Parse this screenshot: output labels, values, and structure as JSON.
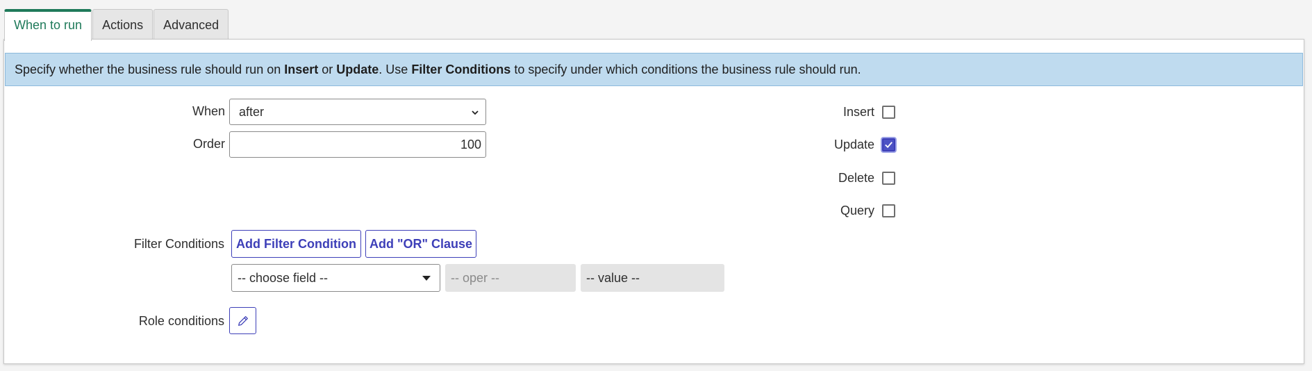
{
  "tabs": [
    {
      "label": "When to run"
    },
    {
      "label": "Actions"
    },
    {
      "label": "Advanced"
    }
  ],
  "info": {
    "t1": "Specify whether the business rule should run on ",
    "insert": "Insert",
    "t2": " or ",
    "update": "Update",
    "t3": ". Use ",
    "filter": "Filter Conditions",
    "t4": " to specify under which conditions the business rule should run."
  },
  "form": {
    "when_label": "When",
    "when_value": "after",
    "order_label": "Order",
    "order_value": "100",
    "checkboxes": [
      {
        "label": "Insert",
        "checked": false
      },
      {
        "label": "Update",
        "checked": true
      },
      {
        "label": "Delete",
        "checked": false
      },
      {
        "label": "Query",
        "checked": false
      }
    ],
    "filter_label": "Filter Conditions",
    "add_filter_label": "Add Filter Condition",
    "add_or_label": "Add \"OR\" Clause",
    "field_placeholder": "-- choose field --",
    "oper_placeholder": "-- oper --",
    "value_placeholder": "-- value --",
    "role_label": "Role conditions"
  },
  "colors": {
    "accent": "#3d3fb8",
    "active_tab": "#1f7a5a",
    "info_bg": "#bfdbef"
  },
  "icons": {
    "role_edit": "pencil-icon",
    "when_dropdown": "chevron-down-icon",
    "field_dropdown": "caret-down-icon",
    "update_check": "checkmark-icon"
  }
}
